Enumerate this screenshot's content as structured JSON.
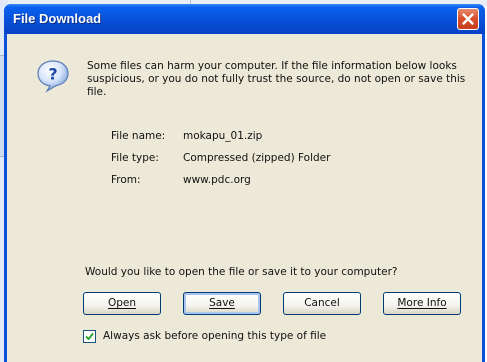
{
  "window": {
    "title": "File Download"
  },
  "warning": {
    "text": "Some files can harm your computer. If the file information below looks suspicious, or you do not fully trust the source, do not open or save this file."
  },
  "file_info": [
    {
      "label": "File name:",
      "value": "mokapu_01.zip"
    },
    {
      "label": "File type:",
      "value": "Compressed (zipped) Folder"
    },
    {
      "label": "From:",
      "value": "www.pdc.org"
    }
  ],
  "prompt": {
    "question": "Would you like to open the file or save it to your computer?"
  },
  "buttons": {
    "open": "Open",
    "save": "Save",
    "cancel": "Cancel",
    "more_info": "More Info"
  },
  "checkbox": {
    "label": "Always ask before opening this type of file",
    "checked": true
  },
  "colors": {
    "titlebar": "#0750d8",
    "client_bg": "#ece9d8",
    "close_button": "#d8502f"
  },
  "icons": {
    "dialog": "question-icon",
    "close": "close-icon",
    "check": "checkmark-icon"
  }
}
